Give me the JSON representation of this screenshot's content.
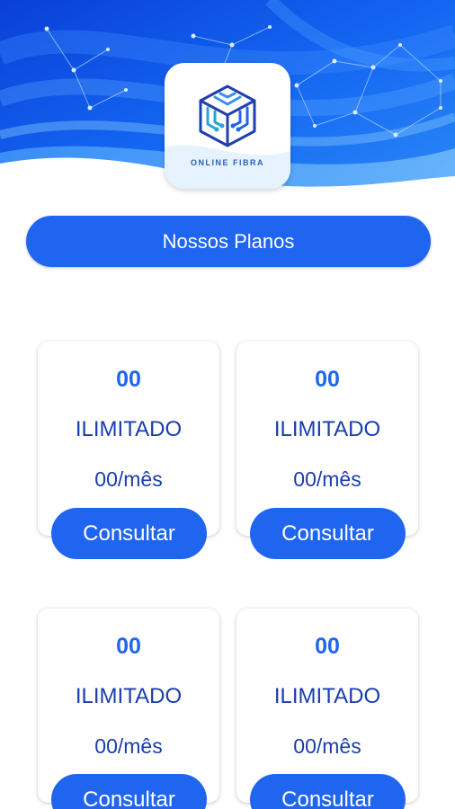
{
  "brand": {
    "logo_text": "ONLINE FIBRA",
    "primary_color": "#1f65f0",
    "text_color": "#1a3dab"
  },
  "section": {
    "title": "Nossos Planos"
  },
  "plans": [
    {
      "speed": "00",
      "type": "ILIMITADO",
      "price": "00/mês",
      "button_label": "Consultar"
    },
    {
      "speed": "00",
      "type": "ILIMITADO",
      "price": "00/mês",
      "button_label": "Consultar"
    },
    {
      "speed": "00",
      "type": "ILIMITADO",
      "price": "00/mês",
      "button_label": "Consultar"
    },
    {
      "speed": "00",
      "type": "ILIMITADO",
      "price": "00/mês",
      "button_label": "Consultar"
    }
  ]
}
